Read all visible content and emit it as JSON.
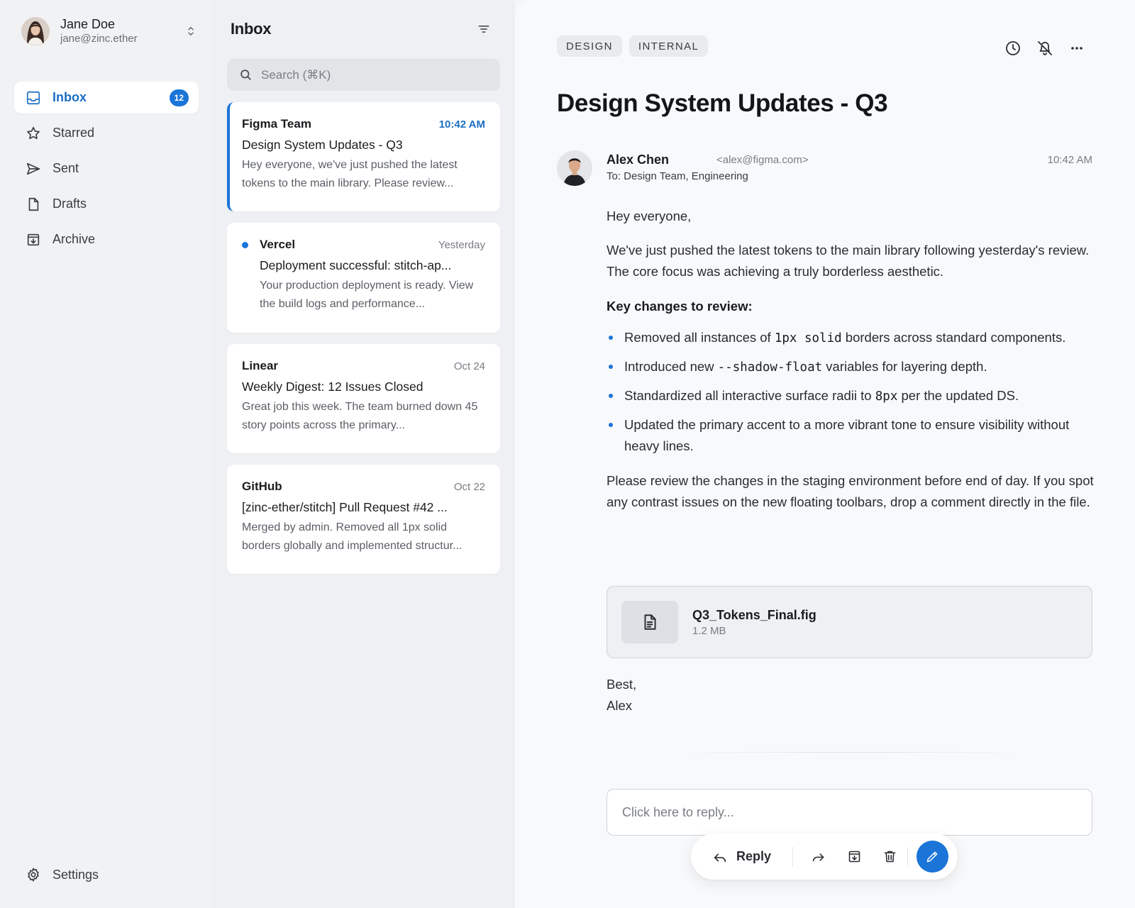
{
  "account": {
    "name": "Jane Doe",
    "email": "jane@zinc.ether"
  },
  "nav": {
    "inbox": {
      "label": "Inbox",
      "count": "12"
    },
    "starred": {
      "label": "Starred"
    },
    "sent": {
      "label": "Sent"
    },
    "drafts": {
      "label": "Drafts"
    },
    "archive": {
      "label": "Archive"
    },
    "settings": {
      "label": "Settings"
    }
  },
  "list": {
    "title": "Inbox",
    "search_placeholder": "Search (⌘K)",
    "messages": [
      {
        "sender": "Figma Team",
        "time": "10:42 AM",
        "subject": "Design System Updates - Q3",
        "preview": "Hey everyone, we've just pushed the latest tokens to the main library. Please review...",
        "selected": true,
        "unread": false
      },
      {
        "sender": "Vercel",
        "time": "Yesterday",
        "subject": "Deployment successful: stitch-ap...",
        "preview": "Your production deployment is ready. View the build logs and performance...",
        "selected": false,
        "unread": true
      },
      {
        "sender": "Linear",
        "time": "Oct 24",
        "subject": "Weekly Digest: 12 Issues Closed",
        "preview": "Great job this week. The team burned down 45 story points across the primary...",
        "selected": false,
        "unread": false
      },
      {
        "sender": "GitHub",
        "time": "Oct 22",
        "subject": "[zinc-ether/stitch] Pull Request #42 ...",
        "preview": "Merged by admin. Removed all 1px solid borders globally and implemented structur...",
        "selected": false,
        "unread": false
      }
    ]
  },
  "email": {
    "tags": [
      "DESIGN",
      "INTERNAL"
    ],
    "subject": "Design System Updates - Q3",
    "from_name": "Alex Chen",
    "from_email": "<alex@figma.com>",
    "to": "To: Design Team, Engineering",
    "time": "10:42 AM",
    "greeting": "Hey everyone,",
    "intro": "We've just pushed the latest tokens to the main library following yesterday's review. The core focus was achieving a truly borderless aesthetic.",
    "changes_heading": "Key changes to review:",
    "changes": [
      {
        "before": "Removed all instances of ",
        "code": "1px solid",
        "after": " borders across standard components."
      },
      {
        "before": "Introduced new ",
        "code": "--shadow-float",
        "after": " variables for layering depth."
      },
      {
        "before": "Standardized all interactive surface radii to ",
        "code": "8px",
        "after": " per the updated DS."
      },
      {
        "before": "Updated the primary accent to a more vibrant tone to ensure visibility without heavy lines.",
        "code": "",
        "after": ""
      }
    ],
    "closing_paragraph": "Please review the changes in the staging environment before end of day. If you spot any contrast issues on the new floating toolbars, drop a comment directly in the file.",
    "attachment": {
      "name": "Q3_Tokens_Final.fig",
      "size": "1.2 MB"
    },
    "signoff": "Best,",
    "signature": "Alex"
  },
  "reply": {
    "placeholder": "Click here to reply...",
    "button_label": "Reply"
  },
  "colors": {
    "accent": "#1b74d8",
    "sidebar_bg": "#f1f2f4",
    "list_bg": "#eef0f3",
    "pane_bg": "#f8f9fb"
  }
}
